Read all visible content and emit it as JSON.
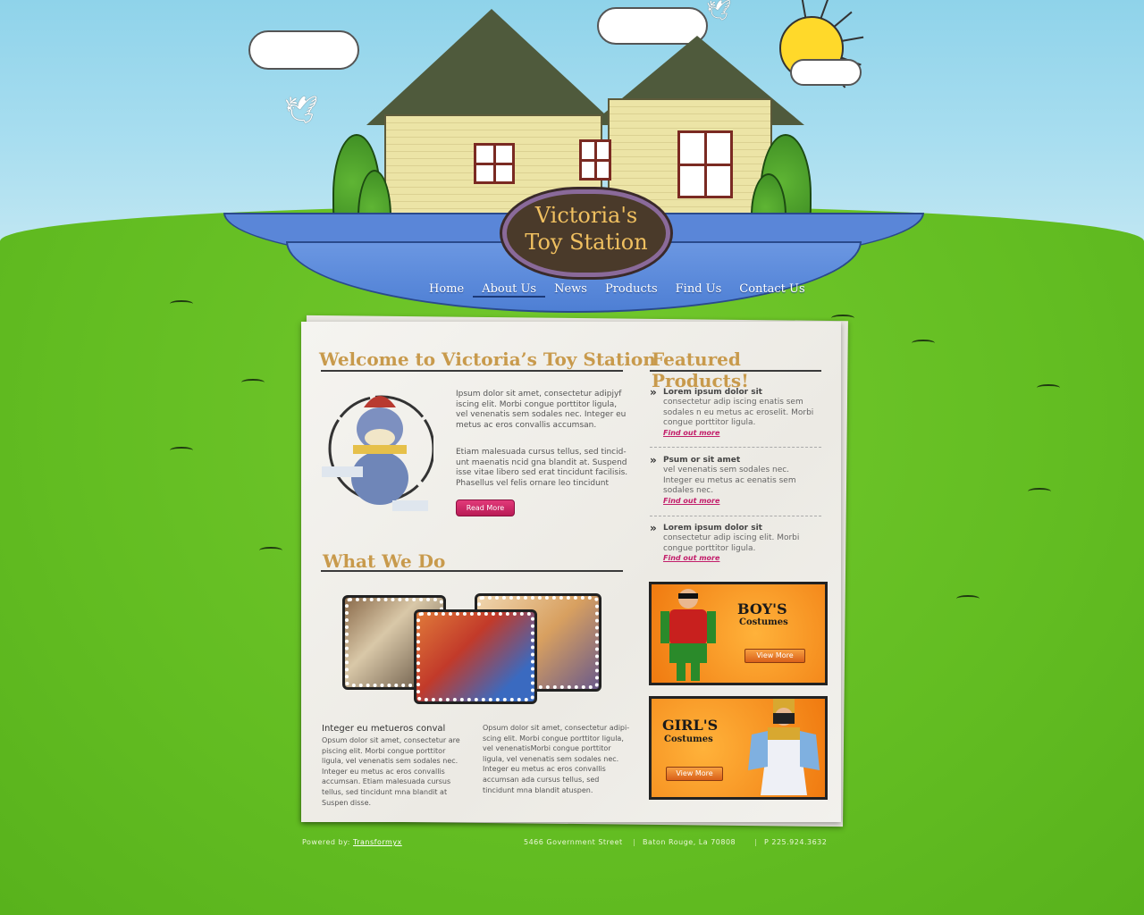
{
  "brand": {
    "line1": "Victoria's",
    "line2": "Toy Station"
  },
  "nav": [
    "Home",
    "About Us",
    "News",
    "Products",
    "Find Us",
    "Contact Us"
  ],
  "nav_active": "About Us",
  "welcome": {
    "heading": "Welcome to Victoria’s Toy Station",
    "para1": "Ipsum dolor sit amet, consectetur adipjyf iscing elit. Morbi congue porttitor ligula, vel venenatis sem sodales nec. Integer eu metus ac eros convallis accumsan.",
    "para2": "Etiam malesuada cursus tellus, sed tincid-unt maenatis ncid gna blandit at. Suspend isse vitae libero sed erat tincidunt facilisis. Phasellus vel felis ornare leo tincidunt",
    "read_more": "Read More"
  },
  "what_we_do": {
    "heading": "What We Do",
    "col1_title": "Integer eu metueros conval",
    "col1_body": "Opsum dolor sit amet, consectetur are piscing elit. Morbi congue porttitor ligula, vel venenatis sem sodales nec. Integer eu metus ac eros convallis accumsan. Etiam malesuada cursus tellus, sed tincidunt mna blandit at Suspen disse.",
    "col2_body": "Opsum dolor sit amet, consectetur adipi-scing elit. Morbi congue porttitor ligula, vel venenatisMorbi congue porttitor ligula, vel venenatis sem sodales nec. Integer eu metus ac eros convallis accumsan ada cursus tellus, sed tincidunt mna blandit atuspen."
  },
  "featured": {
    "heading": "Featured Products!",
    "items": [
      {
        "title": "Lorem ipsum dolor sit",
        "body": "consectetur adip iscing enatis sem sodales n eu metus ac eroselit. Morbi congue porttitor ligula.",
        "link": "Find out more"
      },
      {
        "title": "Psum or sit amet",
        "body": "vel venenatis sem sodales nec. Integer eu metus ac eenatis sem sodales nec.",
        "link": "Find out more"
      },
      {
        "title": "Lorem ipsum dolor sit",
        "body": "consectetur adip iscing elit. Morbi congue porttitor ligula.",
        "link": "Find out more"
      }
    ]
  },
  "promos": {
    "boys": {
      "line1": "BOY'S",
      "line2": "Costumes",
      "button": "View More"
    },
    "girls": {
      "line1": "GIRL'S",
      "line2": "Costumes",
      "button": "View More"
    }
  },
  "footer": {
    "powered_label": "Powered by:",
    "powered_link": "Transformyx",
    "address": "5466 Government Street",
    "city": "Baton Rouge, La 70808",
    "phone": "P 225.924.3632"
  },
  "colors": {
    "heading": "#c89a4c",
    "accent_pink": "#c21d6a",
    "ribbon": "#5a86d8",
    "grass": "#63bd22"
  }
}
